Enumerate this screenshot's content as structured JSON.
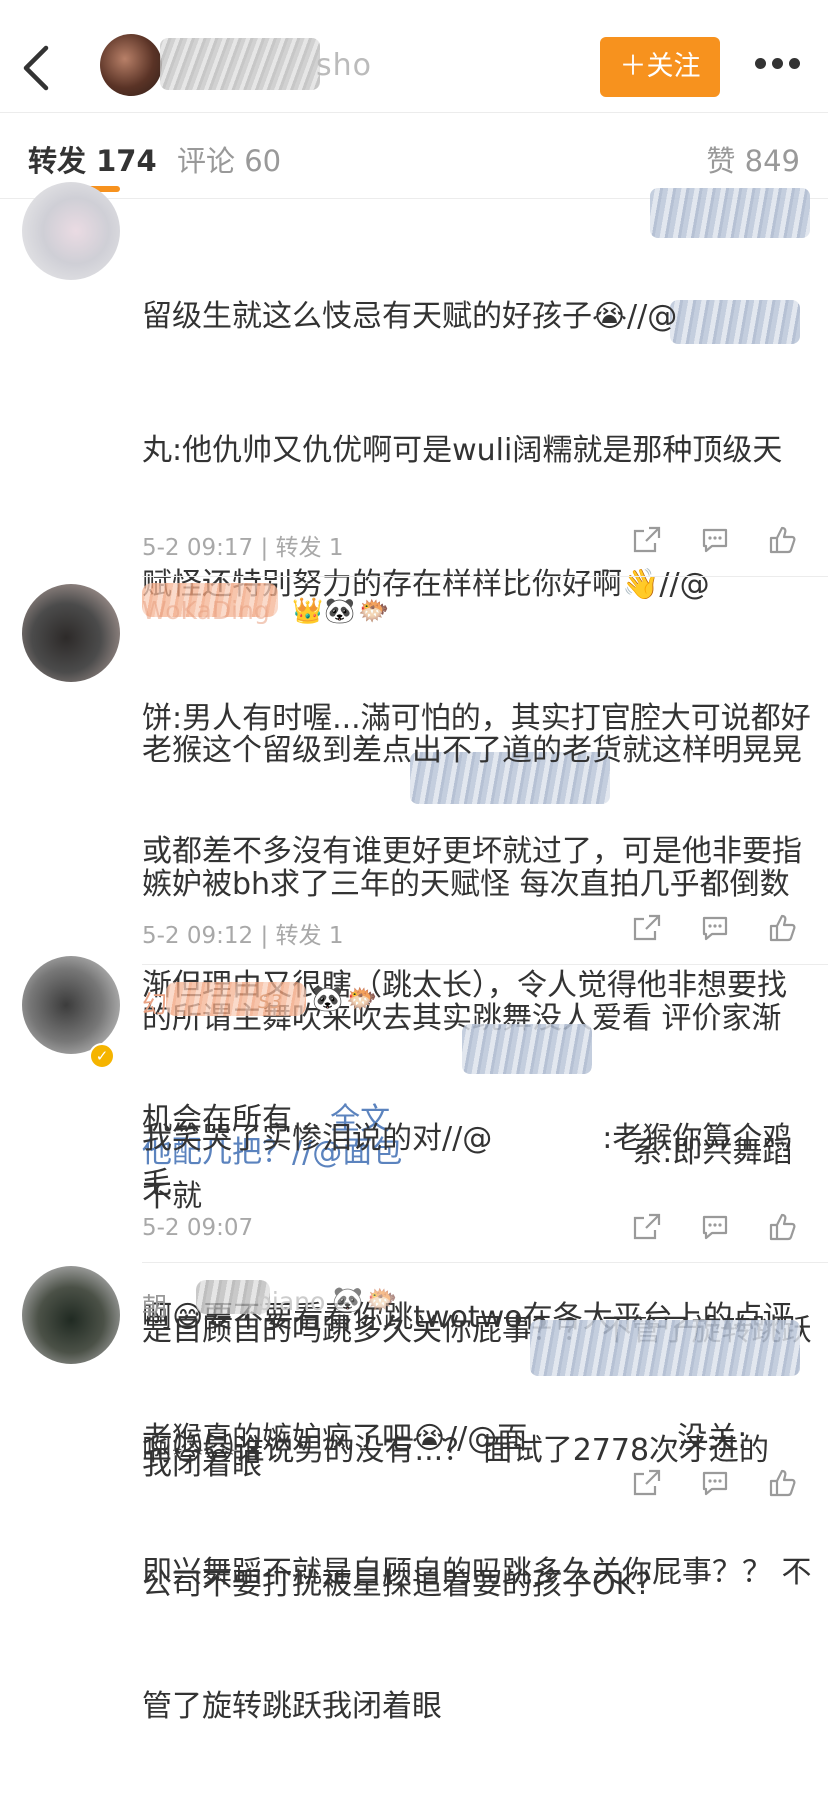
{
  "header": {
    "back_label": "back",
    "name_visible_suffix": "sho",
    "follow_label": "＋关注",
    "more_label": "more"
  },
  "tabs": {
    "repost": "转发 174",
    "comment": "评论 60",
    "like": "赞 849"
  },
  "colors": {
    "accent": "#f7921e",
    "link": "#5b83be",
    "meta": "#a8a8a8",
    "username": "#e8a182"
  },
  "reposts": [
    {
      "username": "",
      "lines": [
        "留级生就这么忮忌有天赋的好孩子😭//@",
        "丸:他仇帅又仇优啊可是wuli阔糯就是那种顶级天",
        "赋怪还特别努力的存在样样比你好啊👋//@",
        "饼:男人有时喔...滿可怕的，其实打官腔大可说都好",
        "或都差不多沒有谁更好更坏就过了，可是他非要指",
        "渐但理由又很瞎（跳太长），令人觉得他非想要找",
        "机会在所有... "
      ],
      "full_text_link": "全文",
      "meta": "5-2 09:17 | 转发 1"
    },
    {
      "username": "WoKaDing",
      "badges": [
        "👑",
        "🐼",
        "🐡"
      ],
      "lines": [
        "老猴这个留级到差点出不了道的老货就这样明晃晃",
        "嫉妒被bh求了三年的天赋怪 每次直拍几乎都倒数",
        "的所谓主舞吹来吹去其实跳舞没人爱看 评价家渐",
        "他配几把？//@面包",
        "是自顾自的吗跳多久关你屁事？？ 不管了旋转跳跃",
        "我闭着眼"
      ],
      "line4_tail": "系:即兴舞蹈不就",
      "meta": "5-2 09:12 | 转发 1"
    },
    {
      "username": "幻",
      "badges": [
        "S3",
        "🐼",
        "🐡"
      ],
      "lines": [
        "我笑哭了实惨泪说的对//@",
        "啊😅要不要看看你跳twotwo在各大平台上的点评",
        "啊🙀🙀谁说男的没有...？ 面试了2778次才进的",
        "公司不要打扰被星探追着要的孩子OK?"
      ],
      "line1_tail": ":老猴你算个鸡毛",
      "meta": "5-2 09:07"
    },
    {
      "username": "朝",
      "username_tail": "piano",
      "badges": [
        "🐼",
        "🐡"
      ],
      "lines": [
        "老猴真的嫉妒疯了吧😭//@面",
        "即兴舞蹈不就是自顾自的吗跳多久关你屁事？？ 不",
        "管了旋转跳跃我闭着眼"
      ],
      "line1_tail": "没关:",
      "meta": ""
    }
  ],
  "icons": [
    "chevron-left-icon",
    "more-dots-icon",
    "share-icon",
    "comment-icon",
    "like-icon"
  ]
}
